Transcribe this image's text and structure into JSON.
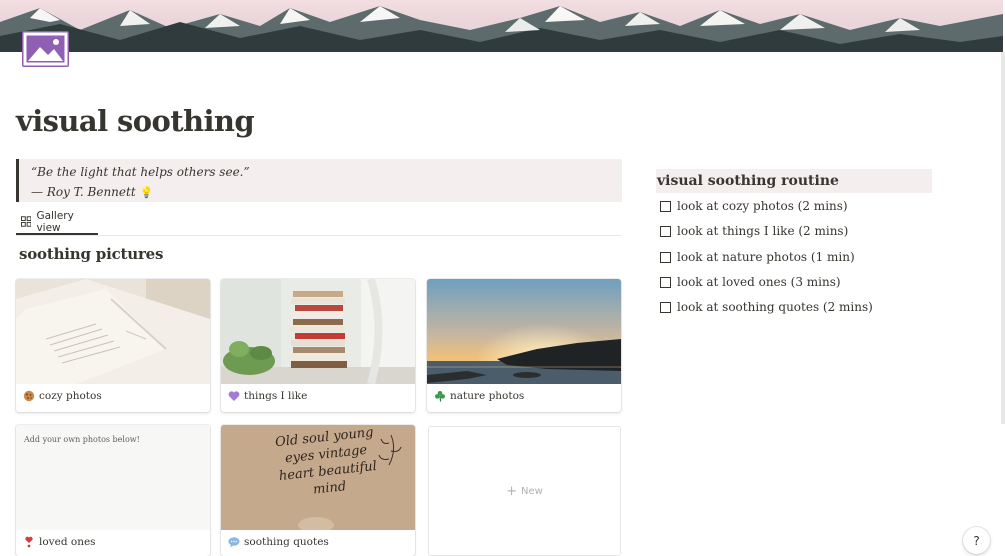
{
  "page": {
    "title": "visual soothing",
    "icon": "image-icon",
    "cover": "mountain-cover"
  },
  "quote": {
    "line1": "“Be the light that helps others see.”",
    "line2": "— Roy T. Bennett",
    "emoji": "lightbulb-icon"
  },
  "view": {
    "tab_label": "Gallery view",
    "tab_icon": "gallery-grid-icon"
  },
  "gallery": {
    "title": "soothing pictures",
    "cards": [
      {
        "label": "cozy photos",
        "emoji": "cookie-icon"
      },
      {
        "label": "things I like",
        "emoji": "purple-heart-icon"
      },
      {
        "label": "nature photos",
        "emoji": "shamrock-icon"
      },
      {
        "label": "loved ones",
        "emoji": "heart-exclamation-icon",
        "note": "Add your own photos below!"
      },
      {
        "label": "soothing quotes",
        "emoji": "speech-bubble-icon",
        "handwriting": "Old soul young eyes vintage heart beautiful mind"
      }
    ],
    "new_label": "New"
  },
  "routine": {
    "title": "visual soothing routine",
    "items": [
      "look at cozy photos (2 mins)",
      "look at things I like (2 mins)",
      "look at nature photos (1 min)",
      "look at loved ones (3 mins)",
      "look at soothing quotes (2 mins)"
    ]
  },
  "help": {
    "label": "?"
  },
  "colors": {
    "accent_purple": "#8e5fb3",
    "callout_bg": "#f4eeee",
    "text": "#37352f"
  }
}
